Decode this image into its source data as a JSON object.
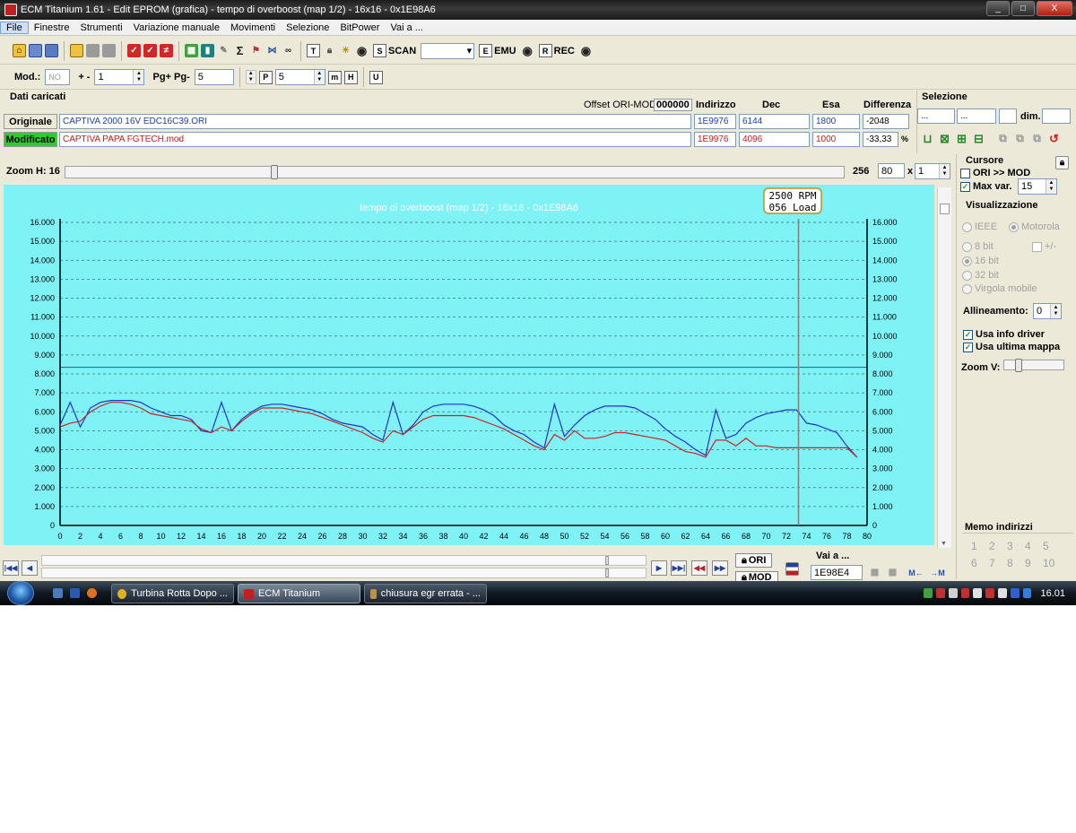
{
  "window": {
    "title": "ECM Titanium 1.61 - Edit EPROM (grafica) - tempo di overboost (map 1/2) - 16x16 - 0x1E98A6",
    "buttons": [
      "_",
      "□",
      "X"
    ]
  },
  "menu": [
    "File",
    "Finestre",
    "Strumenti",
    "Variazione manuale",
    "Movimenti",
    "Selezione",
    "BitPower",
    "Vai a ..."
  ],
  "toolbar1": {
    "scan_label": "SCAN",
    "emu_label": "EMU",
    "rec_label": "REC",
    "scan_combo_value": ""
  },
  "toolbar2": {
    "mod_label": "Mod.:",
    "mod_value": "NO",
    "plusminus_label": "+ -",
    "plusminus_value": "1",
    "pg_label": "Pg+ Pg-",
    "pg_value": "5",
    "p_value": "5"
  },
  "loaded": {
    "section_title": "Dati caricati",
    "offset_label": "Offset ORI-MOD",
    "offset_value": "000000",
    "col_indirizzo": "Indirizzo",
    "col_dec": "Dec",
    "col_esa": "Esa",
    "col_diff": "Differenza",
    "original": {
      "tag": "Originale",
      "file": "CAPTIVA 2000 16V EDC16C39.ORI",
      "address": "1E9976",
      "dec": "6144",
      "esa": "1800",
      "diff": "-2048"
    },
    "modified": {
      "tag": "Modificato",
      "file": "CAPTIVA PAPA FGTECH.mod",
      "address": "1E9976",
      "dec": "4096",
      "esa": "1000",
      "diff": "-33,33",
      "diff_unit": "%"
    }
  },
  "selection": {
    "title": "Selezione",
    "field1": "...",
    "field2": "...",
    "field3": "",
    "dim_label": "dim.",
    "dim_value": ""
  },
  "zoom": {
    "label": "Zoom H: 16",
    "max": "256",
    "value": "80",
    "times": "x",
    "factor": "1"
  },
  "cursor": {
    "title": "Cursore",
    "ori_mod_label": "ORI >> MOD",
    "ori_mod_checked": false,
    "maxvar_label": "Max var.",
    "maxvar_checked": true,
    "maxvar_value": "15"
  },
  "view": {
    "title": "Visualizzazione",
    "ieee": "IEEE",
    "motorola": "Motorola",
    "bit8": "8 bit",
    "plusminus": "+/-",
    "bit16": "16 bit",
    "bit32": "32 bit",
    "float": "Virgola mobile",
    "align_label": "Allineamento:",
    "align_value": "0",
    "info_driver": "Usa info driver",
    "last_map": "Usa ultima mappa",
    "zoomv_label": "Zoom V:"
  },
  "memo": {
    "title": "Memo indirizzi",
    "numbers": [
      "1",
      "2",
      "3",
      "4",
      "5",
      "6",
      "7",
      "8",
      "9",
      "10"
    ]
  },
  "bottom": {
    "ori_button": "ORI",
    "mod_button": "MOD",
    "goto_label": "Vai a ...",
    "goto_value": "1E98E4"
  },
  "taskbar": {
    "items": [
      "Turbina Rotta Dopo ...",
      "ECM Titanium",
      "chiusura egr errata - ..."
    ],
    "clock": "16.01"
  },
  "chart_data": {
    "type": "line",
    "title": "tempo di overboost (map 1/2) - 16x16 - 0x1E98A6",
    "tooltip": [
      "2500 RPM",
      "056 Load"
    ],
    "cursor_x": 73.2,
    "reference_line": 8.35,
    "x_ticks": [
      "0",
      "2",
      "4",
      "6",
      "8",
      "10",
      "12",
      "14",
      "16",
      "18",
      "20",
      "22",
      "24",
      "26",
      "28",
      "30",
      "32",
      "34",
      "36",
      "38",
      "40",
      "42",
      "44",
      "46",
      "48",
      "50",
      "52",
      "54",
      "56",
      "58",
      "60",
      "62",
      "64",
      "66",
      "68",
      "70",
      "72",
      "74",
      "76",
      "78",
      "80"
    ],
    "y_ticks": [
      "0",
      "1.000",
      "2.000",
      "3.000",
      "4.000",
      "5.000",
      "6.000",
      "7.000",
      "8.000",
      "9.000",
      "10.000",
      "11.000",
      "12.000",
      "13.000",
      "14.000",
      "15.000",
      "16.000"
    ],
    "xlim": [
      0,
      80
    ],
    "ylim": [
      0,
      16
    ],
    "grid": true,
    "series": [
      {
        "color": "#2233cc",
        "x": [
          0,
          1,
          2,
          3,
          4,
          5,
          6,
          7,
          8,
          9,
          10,
          11,
          12,
          13,
          14,
          15,
          16,
          17,
          18,
          19,
          20,
          21,
          22,
          23,
          24,
          25,
          26,
          27,
          28,
          29,
          30,
          31,
          32,
          33,
          34,
          35,
          36,
          37,
          38,
          39,
          40,
          41,
          42,
          43,
          44,
          45,
          46,
          47,
          48,
          49,
          50,
          51,
          52,
          53,
          54,
          55,
          56,
          57,
          58,
          59,
          60,
          61,
          62,
          63,
          64,
          65,
          66,
          67,
          68,
          69,
          70,
          71,
          72,
          73,
          74,
          75,
          76,
          77,
          78,
          79
        ],
        "y": [
          5.3,
          6.5,
          5.2,
          6.2,
          6.5,
          6.6,
          6.6,
          6.6,
          6.5,
          6.2,
          6.0,
          5.8,
          5.8,
          5.6,
          5.0,
          4.9,
          6.5,
          5.0,
          5.6,
          6.0,
          6.3,
          6.4,
          6.4,
          6.3,
          6.2,
          6.1,
          5.9,
          5.6,
          5.4,
          5.3,
          5.2,
          4.8,
          4.5,
          6.5,
          4.8,
          5.3,
          6.0,
          6.3,
          6.4,
          6.4,
          6.4,
          6.3,
          6.1,
          5.8,
          5.3,
          5.0,
          4.8,
          4.4,
          4.1,
          6.4,
          4.7,
          5.3,
          5.8,
          6.1,
          6.3,
          6.3,
          6.3,
          6.2,
          5.9,
          5.6,
          5.1,
          4.7,
          4.4,
          4.0,
          3.7,
          6.1,
          4.6,
          4.8,
          5.4,
          5.7,
          5.9,
          6.0,
          6.1,
          6.1,
          5.4,
          5.3,
          5.1,
          4.9,
          4.2,
          3.6
        ]
      },
      {
        "color": "#cc2222",
        "x": [
          0,
          1,
          2,
          3,
          4,
          5,
          6,
          7,
          8,
          9,
          10,
          11,
          12,
          13,
          14,
          15,
          16,
          17,
          18,
          19,
          20,
          21,
          22,
          23,
          24,
          25,
          26,
          27,
          28,
          29,
          30,
          31,
          32,
          33,
          34,
          35,
          36,
          37,
          38,
          39,
          40,
          41,
          42,
          43,
          44,
          45,
          46,
          47,
          48,
          49,
          50,
          51,
          52,
          53,
          54,
          55,
          56,
          57,
          58,
          59,
          60,
          61,
          62,
          63,
          64,
          65,
          66,
          67,
          68,
          69,
          70,
          71,
          72,
          73,
          74,
          75,
          76,
          77,
          78,
          79
        ],
        "y": [
          5.2,
          5.4,
          5.5,
          6.0,
          6.3,
          6.5,
          6.5,
          6.4,
          6.2,
          5.9,
          5.8,
          5.7,
          5.6,
          5.5,
          5.1,
          4.9,
          5.2,
          5.0,
          5.5,
          5.9,
          6.2,
          6.2,
          6.2,
          6.1,
          6.0,
          5.9,
          5.7,
          5.5,
          5.3,
          5.1,
          4.9,
          4.6,
          4.4,
          5.0,
          4.8,
          5.2,
          5.6,
          5.8,
          5.8,
          5.8,
          5.8,
          5.7,
          5.5,
          5.3,
          5.1,
          4.8,
          4.5,
          4.2,
          4.0,
          4.8,
          4.5,
          5.0,
          4.6,
          4.6,
          4.7,
          4.9,
          4.9,
          4.8,
          4.7,
          4.6,
          4.5,
          4.2,
          3.9,
          3.8,
          3.6,
          4.5,
          4.5,
          4.2,
          4.6,
          4.2,
          4.2,
          4.1,
          4.1,
          4.1,
          4.1,
          4.1,
          4.1,
          4.1,
          4.1,
          3.6
        ]
      }
    ]
  }
}
